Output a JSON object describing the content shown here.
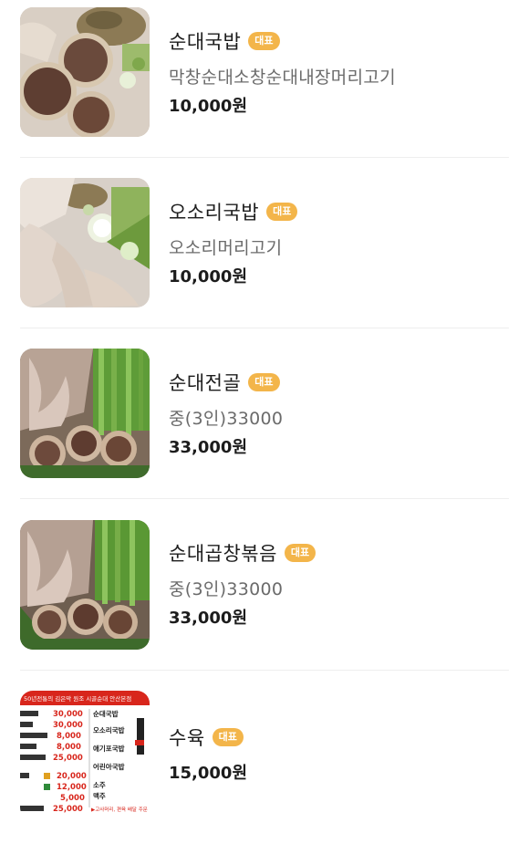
{
  "menu": {
    "items": [
      {
        "name": "순대국밥",
        "badge": "대표",
        "description": "막창순대소창순대내장머리고기",
        "price": "10,000원",
        "image_icon": "sundae-gukbap-photo"
      },
      {
        "name": "오소리국밥",
        "badge": "대표",
        "description": "오소리머리고기",
        "price": "10,000원",
        "image_icon": "osori-gukbap-photo"
      },
      {
        "name": "순대전골",
        "badge": "대표",
        "description": "중(3인)33000",
        "price": "33,000원",
        "image_icon": "sundae-jeongol-photo"
      },
      {
        "name": "순대곱창볶음",
        "badge": "대표",
        "description": "중(3인)33000",
        "price": "33,000원",
        "image_icon": "sundae-gopchang-photo"
      },
      {
        "name": "수육",
        "badge": "대표",
        "description": "",
        "price": "15,000원",
        "image_icon": "menu-board-photo"
      }
    ]
  },
  "menu_board": {
    "header": "50년전통의 김은막 원조 시골순대 안산본점",
    "left_prices": [
      "30,000",
      "30,000",
      "8,000",
      "8,000",
      "25,000",
      "20,000",
      "12,000",
      "5,000",
      "25,000"
    ],
    "right_items": [
      "순대국밥",
      "오소리국밥",
      "애기포국밥",
      "어린아국밥",
      "소주",
      "맥주"
    ],
    "footer": "▶고사머리, 편육 배달 주문"
  },
  "colors": {
    "badge": "#f3b54a",
    "divider": "#eeeeee",
    "board_red": "#d8261c"
  }
}
